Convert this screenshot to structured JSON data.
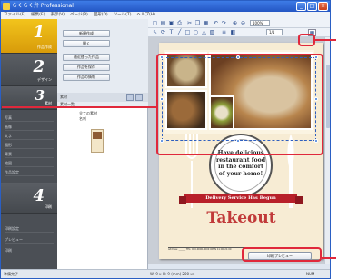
{
  "window": {
    "title": "らくらく弁 Professional",
    "controls": [
      "_",
      "□",
      "×"
    ]
  },
  "menu": [
    "ファイル(F)",
    "編集(E)",
    "表示(V)",
    "ページ(P)",
    "図形(D)",
    "ツール(T)",
    "ヘルプ(H)"
  ],
  "steps": [
    {
      "num": "1",
      "label": "作品作成"
    },
    {
      "num": "2",
      "label": "デザイン"
    },
    {
      "num": "3",
      "label": "素材"
    },
    {
      "num": "4",
      "label": "印刷"
    }
  ],
  "step3_items": [
    "写真",
    "画像",
    "文字",
    "図形",
    "背景",
    "地図",
    "作品設定"
  ],
  "step4_items": [
    "印刷設定",
    "プレビュー",
    "印刷"
  ],
  "task_buttons": [
    "新規作成",
    "開く",
    "最近使った作品",
    "作品を保存",
    "作品の情報"
  ],
  "catalog": {
    "header": "素材",
    "list_header": "素材一覧",
    "tree_items": [
      "全ての素材",
      "名刺"
    ]
  },
  "toolbar": {
    "zoom": "100%",
    "page_label": "1/1"
  },
  "canvas": {
    "circle_text": "Have delicious\nrestaurant food\nin the comfort\nof your home!",
    "ribbon_text": "Delivery Service Has Begun",
    "headline": "Takeout",
    "footer_text": "Address: ______  TEL: 000-0000-0000  OPEN 11:00–21:00"
  },
  "preview_button": "印刷プレビュー",
  "status": {
    "left": "準備完了",
    "mid": "W: 9 x H: 9 (mm)  200 x4",
    "right": "NUM"
  },
  "colors": {
    "accent": "#e0283b",
    "title_blue": "#2456c4",
    "ribbon": "#b8202a",
    "headline": "#c13a3a",
    "step_active": "#f2c41c"
  }
}
